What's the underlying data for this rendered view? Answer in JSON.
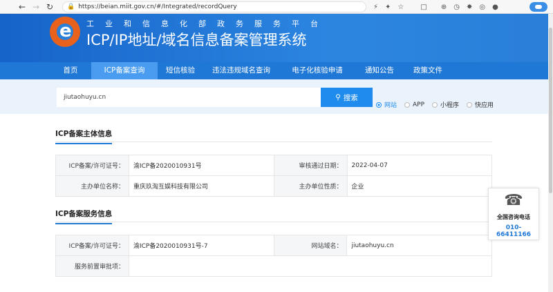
{
  "browser": {
    "url": "https://beian.miit.gov.cn/#/Integrated/recordQuery"
  },
  "header": {
    "subtitle": "工业和信息化部政务服务平台",
    "title": "ICP/IP地址/域名信息备案管理系统"
  },
  "nav": {
    "items": [
      "首页",
      "ICP备案查询",
      "短信核验",
      "违法违规域名查询",
      "电子化核验申请",
      "通知公告",
      "政策文件"
    ],
    "active_index": 1
  },
  "search": {
    "value": "jiutaohuyu.cn",
    "button_label": "搜索",
    "types": [
      "网站",
      "APP",
      "小程序",
      "快应用"
    ],
    "selected_type": "网站"
  },
  "sections": {
    "subject": {
      "title": "ICP备案主体信息",
      "rows": [
        {
          "label1": "ICP备案/许可证号：",
          "value1": "渝ICP备2020010931号",
          "label2": "审核通过日期：",
          "value2": "2022-04-07"
        },
        {
          "label1": "主办单位名称：",
          "value1": "重庆玖淘互娱科技有限公司",
          "label2": "主办单位性质：",
          "value2": "企业"
        }
      ]
    },
    "service": {
      "title": "ICP备案服务信息",
      "rows": [
        {
          "label1": "ICP备案/许可证号：",
          "value1": "渝ICP备2020010931号-7",
          "label2": "网站域名：",
          "value2": "jiutaohuyu.cn"
        },
        {
          "label1": "服务前置审批项：",
          "value1": "",
          "label2": "",
          "value2": ""
        }
      ]
    }
  },
  "contact": {
    "label": "全国咨询电话",
    "phone": "010-66411166"
  },
  "colors": {
    "primary": "#1f78d6",
    "nav_active": "#4a9cf0",
    "logo": "#e8611d"
  }
}
